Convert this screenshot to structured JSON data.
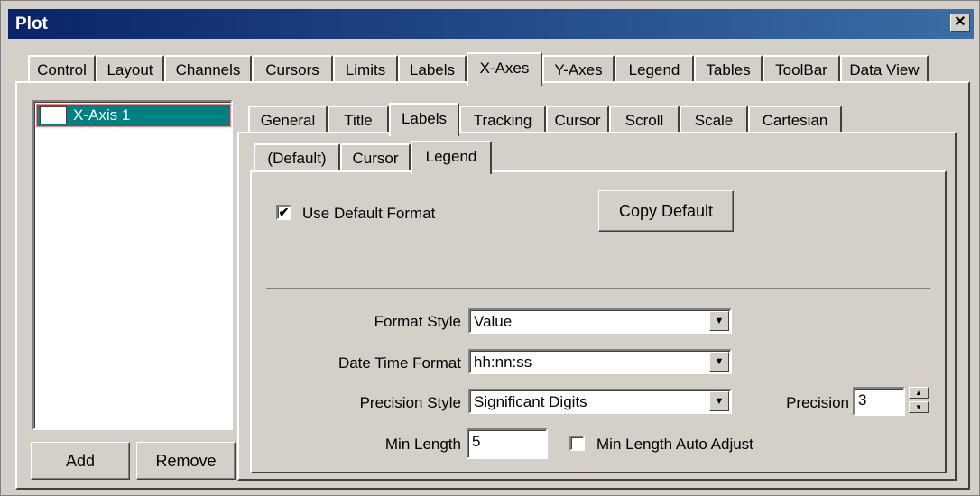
{
  "window": {
    "title": "Plot",
    "close_glyph": "✕"
  },
  "main_tabs": [
    "Control",
    "Layout",
    "Channels",
    "Cursors",
    "Limits",
    "Labels",
    "X-Axes",
    "Y-Axes",
    "Legend",
    "Tables",
    "ToolBar",
    "Data View"
  ],
  "main_tab_active": "X-Axes",
  "axis_list": {
    "items": [
      "X-Axis 1"
    ],
    "add_label": "Add",
    "remove_label": "Remove"
  },
  "sub_tabs": [
    "General",
    "Title",
    "Labels",
    "Tracking",
    "Cursor",
    "Scroll",
    "Scale",
    "Cartesian"
  ],
  "sub_tab_active": "Labels",
  "label_tabs": [
    "(Default)",
    "Cursor",
    "Legend"
  ],
  "label_tab_active": "Legend",
  "legend_page": {
    "use_default_label": "Use Default Format",
    "use_default_checked": true,
    "check_glyph": "✔",
    "copy_default_label": "Copy Default",
    "format_style_label": "Format Style",
    "format_style_value": "Value",
    "date_time_label": "Date Time Format",
    "date_time_value": "hh:nn:ss",
    "precision_style_label": "Precision Style",
    "precision_style_value": "Significant Digits",
    "precision_label": "Precision",
    "precision_value": "3",
    "min_length_label": "Min Length",
    "min_length_value": "5",
    "min_length_auto_label": "Min Length Auto Adjust",
    "min_length_auto_checked": false,
    "dropdown_glyph": "▼",
    "spin_up_glyph": "▲",
    "spin_down_glyph": "▼"
  }
}
